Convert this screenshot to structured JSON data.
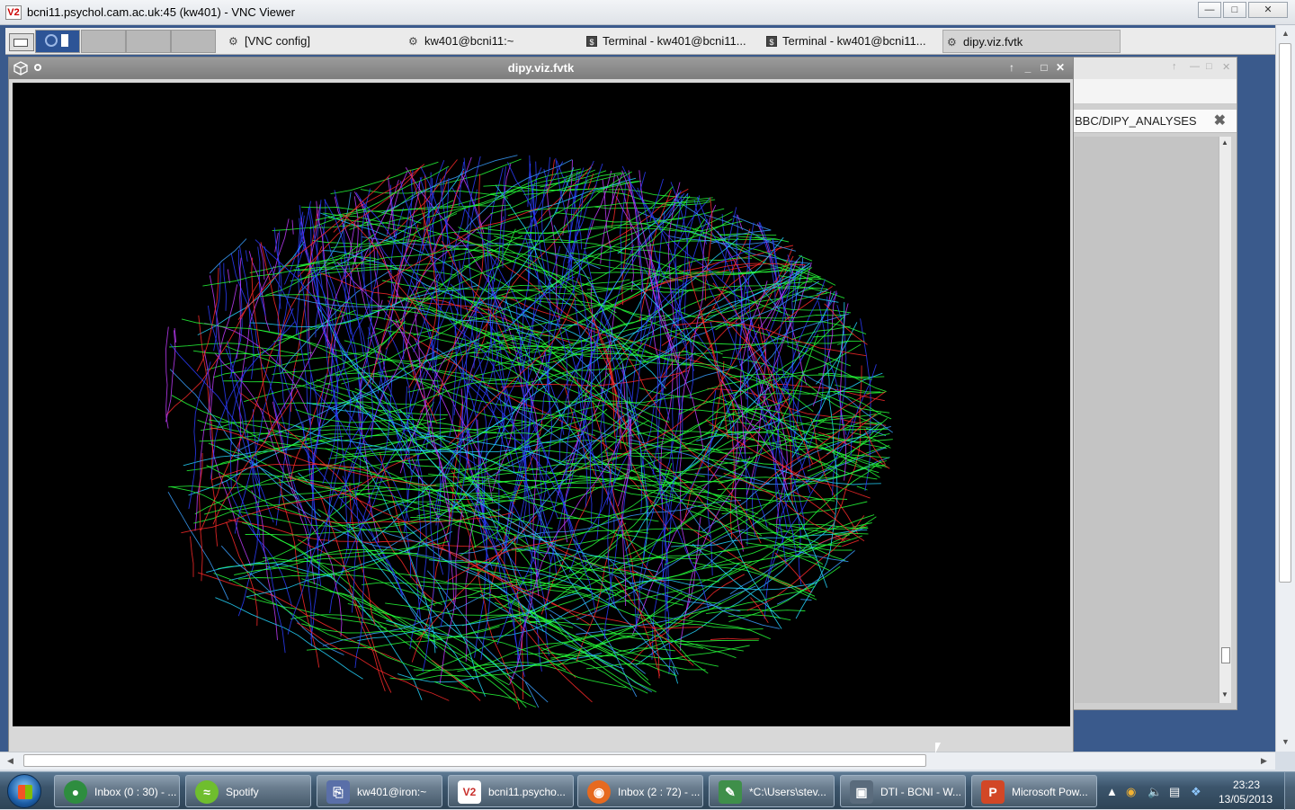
{
  "vnc": {
    "title": "bcni11.psychol.cam.ac.uk:45 (kw401) - VNC Viewer",
    "app_icon": "V2",
    "controls": [
      "minimize-icon",
      "maximize-icon",
      "close-icon"
    ]
  },
  "gnome_panel": {
    "tasks": [
      {
        "label": "[VNC config]",
        "icon": "gear-icon"
      },
      {
        "label": "kw401@bcni11:~",
        "icon": "gear-icon"
      },
      {
        "label": "Terminal - kw401@bcni11...",
        "icon": "terminal-icon"
      },
      {
        "label": "Terminal - kw401@bcni11...",
        "icon": "terminal-icon"
      },
      {
        "label": "dipy.viz.fvtk",
        "icon": "gear-icon",
        "active": true
      }
    ]
  },
  "dipy_window": {
    "title": "dipy.viz.fvtk",
    "content": "3D tractography streamlines rendered on black background (directionally colour-coded: red/green/blue)",
    "colors": [
      "#ff2a2a",
      "#26ff3a",
      "#2b3dff",
      "#24d6ff",
      "#c23cff",
      "#3aa0ff"
    ]
  },
  "bg_window": {
    "path": "BBC/DIPY_ANALYSES"
  },
  "taskbar": {
    "items": [
      {
        "label": "Inbox (0 : 30) - ...",
        "icon": "chrome-icon",
        "color": "#2e8d3f"
      },
      {
        "label": "Spotify",
        "icon": "spotify-icon",
        "color": "#6fbe2e"
      },
      {
        "label": "kw401@iron:~",
        "icon": "putty-icon",
        "color": "#5a6fa8"
      },
      {
        "label": "bcni11.psycho...",
        "icon": "vnc-icon",
        "color": "#c9302c"
      },
      {
        "label": "Inbox (2 : 72) - ...",
        "icon": "firefox-icon",
        "color": "#e66a1f"
      },
      {
        "label": "*C:\\Users\\stev...",
        "icon": "notepad-icon",
        "color": "#3f8f4a"
      },
      {
        "label": "DTI - BCNI - W...",
        "icon": "network-drive-icon",
        "color": "#5a6b7c"
      },
      {
        "label": "Microsoft Pow...",
        "icon": "powerpoint-icon",
        "color": "#d24726"
      }
    ],
    "clock_time": "23:23",
    "clock_date": "13/05/2013"
  }
}
